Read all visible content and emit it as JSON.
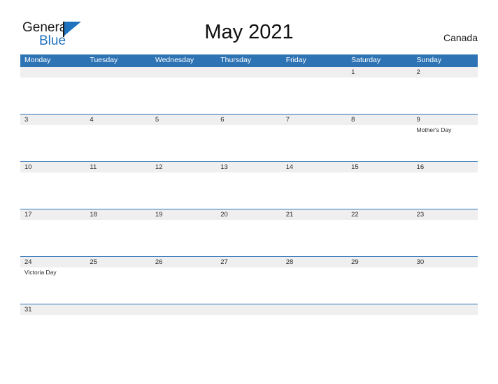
{
  "brand": {
    "name_top": "General",
    "name_bottom": "Blue",
    "flag_icon": "flag-triangle-icon",
    "accent_color": "#1f72bd"
  },
  "header": {
    "title": "May 2021",
    "country": "Canada"
  },
  "colors": {
    "header_blue": "#2e74b5",
    "number_band_gray": "#efefef",
    "rule_blue": "#2e74b5",
    "text_dark": "#2a2a2a",
    "page_background": "#ffffff"
  },
  "calendar": {
    "month": "May",
    "year": "2021",
    "weekday_headers": [
      "Monday",
      "Tuesday",
      "Wednesday",
      "Thursday",
      "Friday",
      "Saturday",
      "Sunday"
    ],
    "weeks": [
      {
        "height": "tall",
        "days": [
          {
            "number": "",
            "event": ""
          },
          {
            "number": "",
            "event": ""
          },
          {
            "number": "",
            "event": ""
          },
          {
            "number": "",
            "event": ""
          },
          {
            "number": "",
            "event": ""
          },
          {
            "number": "1",
            "event": ""
          },
          {
            "number": "2",
            "event": ""
          }
        ]
      },
      {
        "height": "tall",
        "days": [
          {
            "number": "3",
            "event": ""
          },
          {
            "number": "4",
            "event": ""
          },
          {
            "number": "5",
            "event": ""
          },
          {
            "number": "6",
            "event": ""
          },
          {
            "number": "7",
            "event": ""
          },
          {
            "number": "8",
            "event": ""
          },
          {
            "number": "9",
            "event": "Mother's Day"
          }
        ]
      },
      {
        "height": "tall",
        "days": [
          {
            "number": "10",
            "event": ""
          },
          {
            "number": "11",
            "event": ""
          },
          {
            "number": "12",
            "event": ""
          },
          {
            "number": "13",
            "event": ""
          },
          {
            "number": "14",
            "event": ""
          },
          {
            "number": "15",
            "event": ""
          },
          {
            "number": "16",
            "event": ""
          }
        ]
      },
      {
        "height": "tall",
        "days": [
          {
            "number": "17",
            "event": ""
          },
          {
            "number": "18",
            "event": ""
          },
          {
            "number": "19",
            "event": ""
          },
          {
            "number": "20",
            "event": ""
          },
          {
            "number": "21",
            "event": ""
          },
          {
            "number": "22",
            "event": ""
          },
          {
            "number": "23",
            "event": ""
          }
        ]
      },
      {
        "height": "tall",
        "days": [
          {
            "number": "24",
            "event": "Victoria Day"
          },
          {
            "number": "25",
            "event": ""
          },
          {
            "number": "26",
            "event": ""
          },
          {
            "number": "27",
            "event": ""
          },
          {
            "number": "28",
            "event": ""
          },
          {
            "number": "29",
            "event": ""
          },
          {
            "number": "30",
            "event": ""
          }
        ]
      },
      {
        "height": "short",
        "days": [
          {
            "number": "31",
            "event": ""
          },
          {
            "number": "",
            "event": ""
          },
          {
            "number": "",
            "event": ""
          },
          {
            "number": "",
            "event": ""
          },
          {
            "number": "",
            "event": ""
          },
          {
            "number": "",
            "event": ""
          },
          {
            "number": "",
            "event": ""
          }
        ]
      }
    ]
  }
}
